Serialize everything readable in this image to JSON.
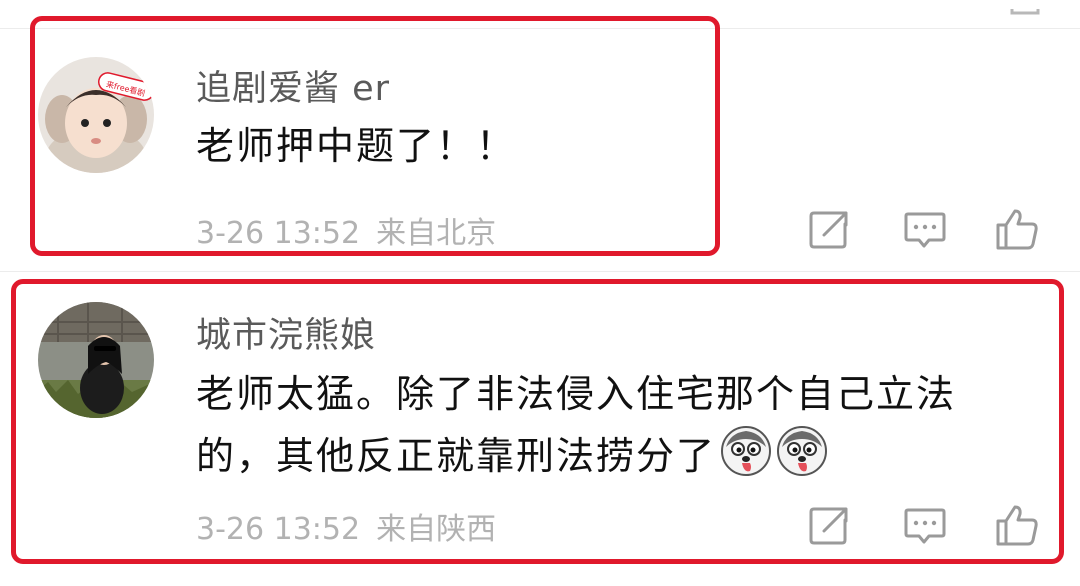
{
  "comments": [
    {
      "username": "追剧爱酱 er",
      "avatar_badge": "来free看剧",
      "lines": [
        "老师押中题了！！"
      ],
      "time": "3-26 13:52",
      "location": "来自北京",
      "emojis": []
    },
    {
      "username": "城市浣熊娘",
      "lines": [
        "老师太猛。除了非法侵入住宅那个自己立法",
        "的，其他反正就靠刑法捞分了"
      ],
      "time": "3-26 13:52",
      "location": "来自陕西",
      "emojis": [
        "husky-emoji",
        "husky-emoji"
      ]
    }
  ],
  "icons": {
    "share": "share-icon",
    "reply": "comment-icon",
    "like": "thumbs-up-icon"
  },
  "colors": {
    "highlight": "#e0192c",
    "username": "#5a5a5a",
    "text": "#111111",
    "meta": "#b2b2b2",
    "icon": "#9a9a9a"
  }
}
